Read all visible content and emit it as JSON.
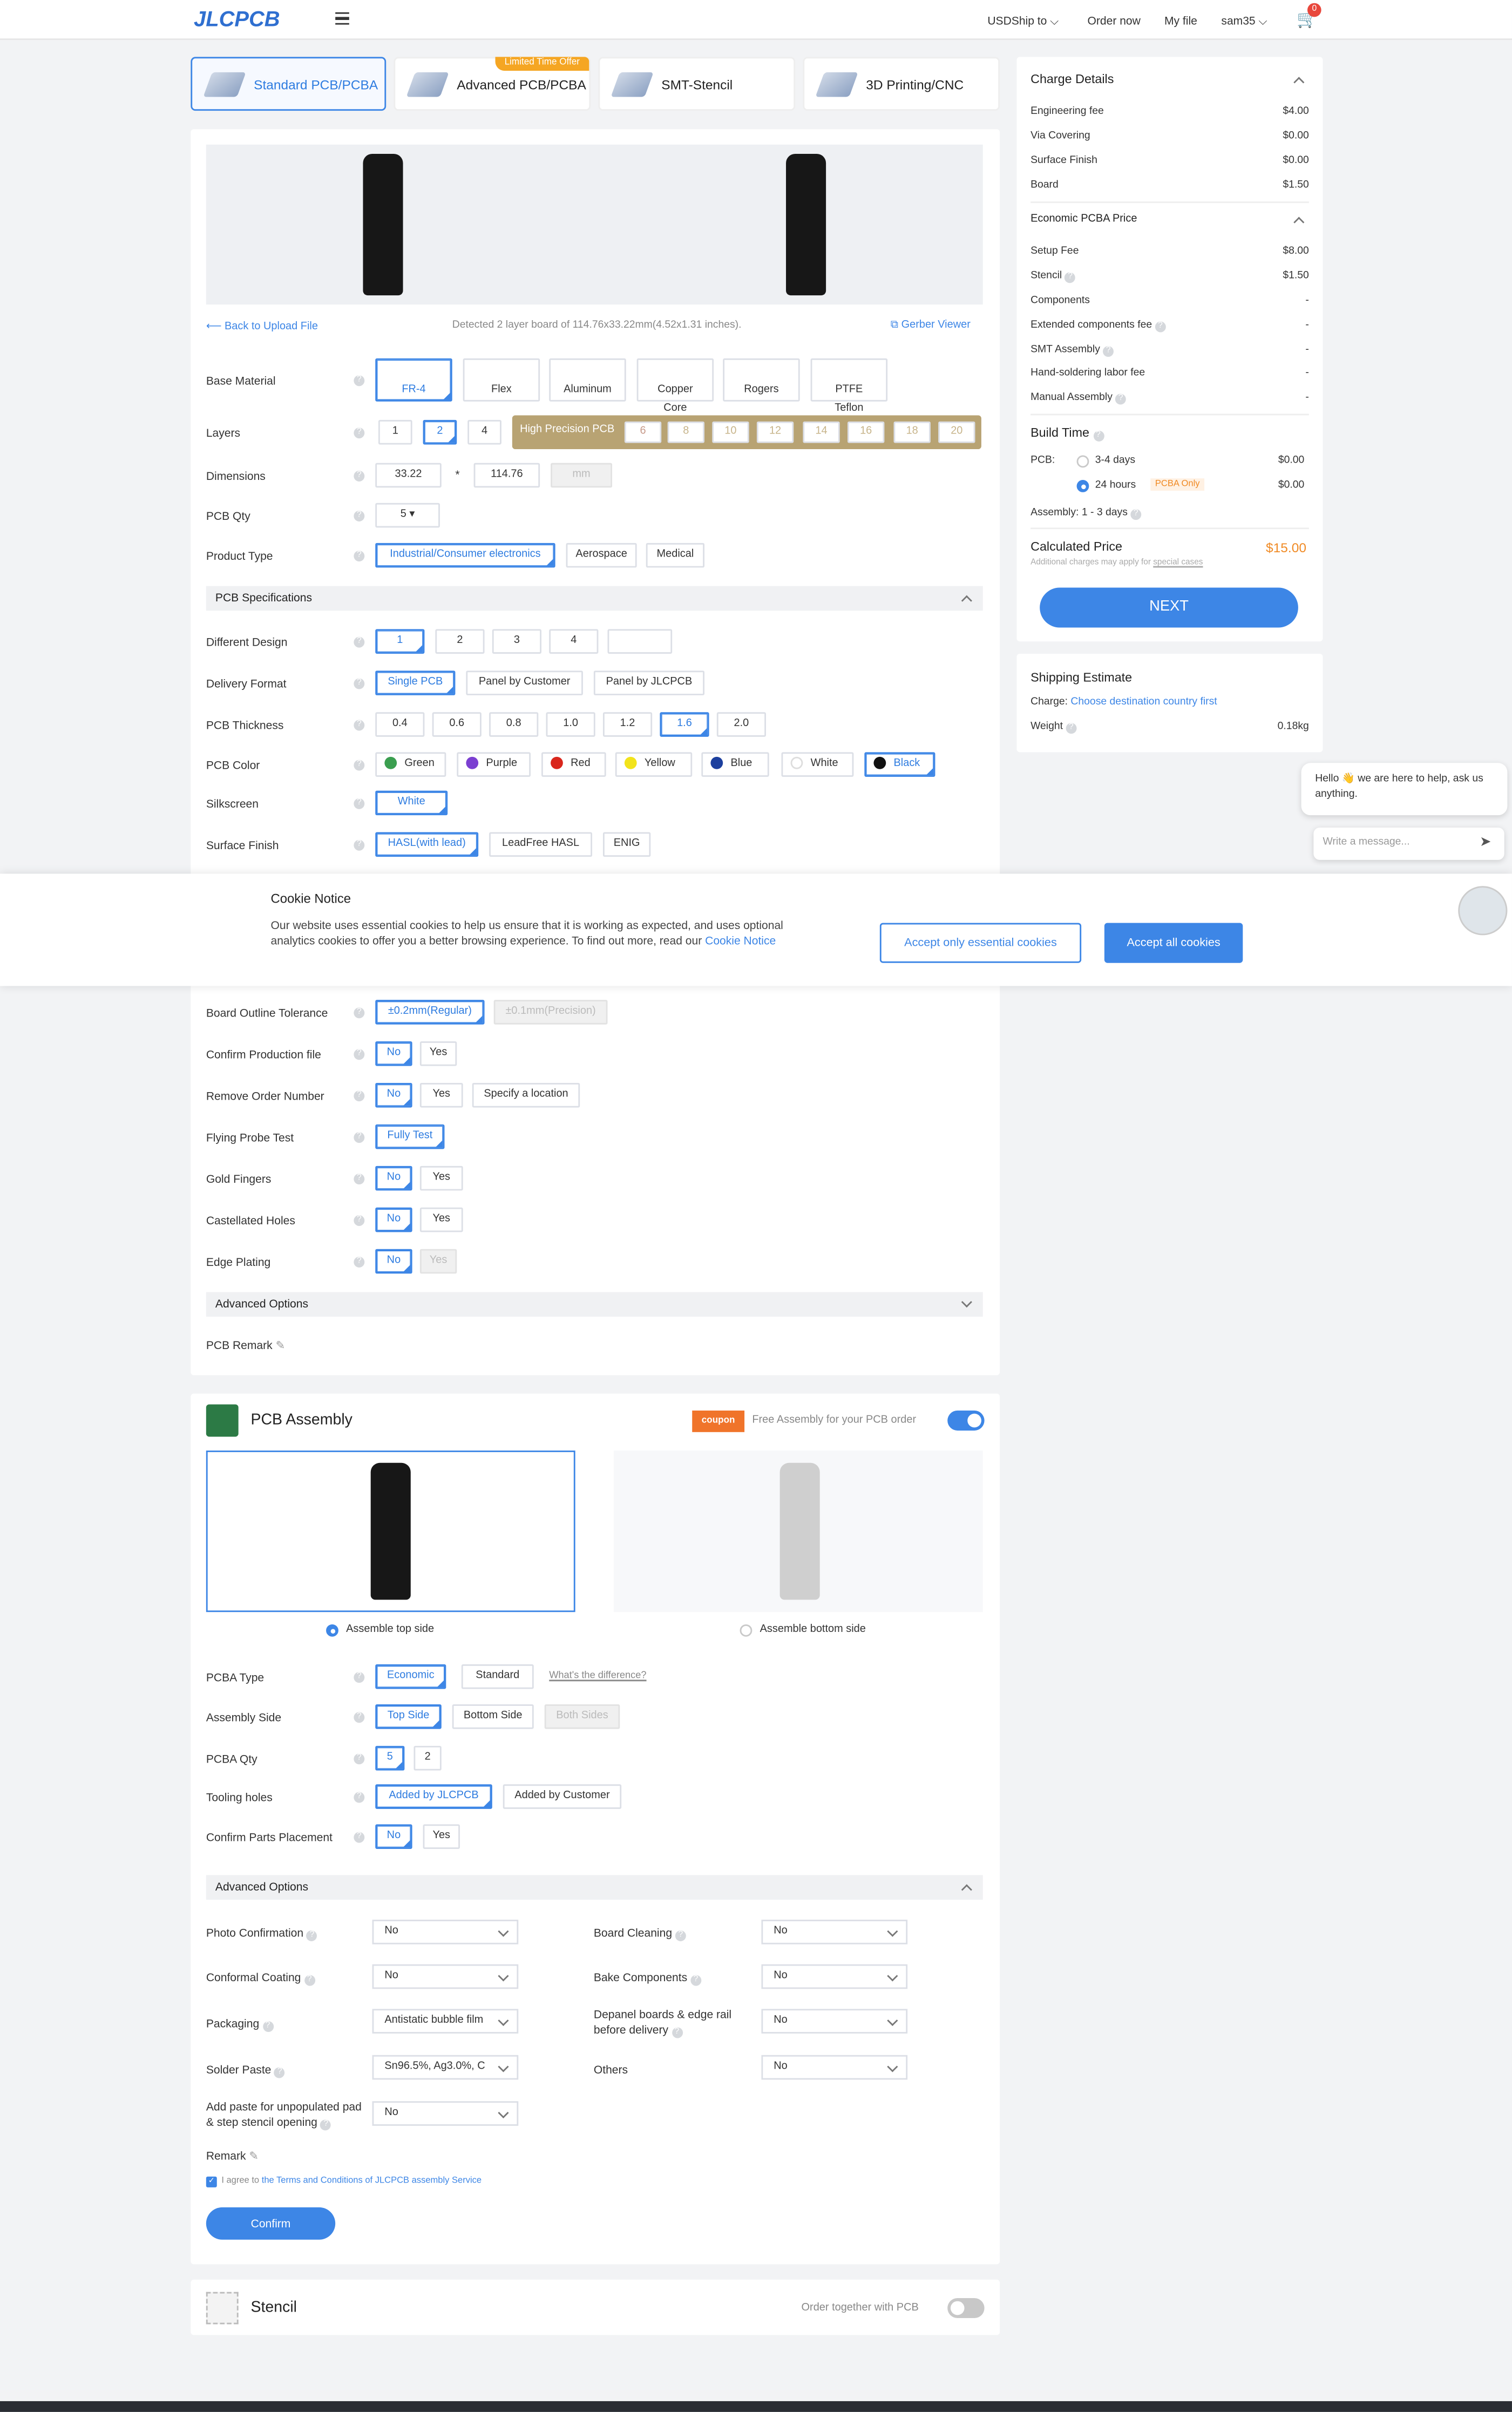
{
  "header": {
    "logo": "JLCPCB",
    "currency": "USD",
    "ship_to": "Ship to",
    "order_now": "Order now",
    "my_file": "My file",
    "user": "sam35",
    "cart_count": "0"
  },
  "tabs": [
    {
      "label": "Standard PCB/PCBA"
    },
    {
      "label": "Advanced PCB/PCBA",
      "badge": "Limited Time Offer"
    },
    {
      "label": "SMT-Stencil"
    },
    {
      "label": "3D Printing/CNC"
    }
  ],
  "upload": {
    "back": "Back to Upload File",
    "detected": "Detected 2 layer board of 114.76x33.22mm(4.52x1.31 inches).",
    "gerber_viewer": "Gerber Viewer"
  },
  "pcb": {
    "base_material": {
      "label": "Base Material",
      "options": [
        "FR-4",
        "Flex",
        "Aluminum",
        "Copper Core",
        "Rogers",
        "PTFE Teflon"
      ]
    },
    "layers": {
      "label": "Layers",
      "options": [
        "1",
        "2",
        "4"
      ],
      "hp_label": "High Precision PCB",
      "hp_options": [
        "6",
        "8",
        "10",
        "12",
        "14",
        "16",
        "18",
        "20"
      ]
    },
    "dimensions": {
      "label": "Dimensions",
      "width": "33.22",
      "sep": "*",
      "height": "114.76",
      "unit": "mm"
    },
    "qty": {
      "label": "PCB Qty",
      "value": "5"
    },
    "product_type": {
      "label": "Product Type",
      "options": [
        "Industrial/Consumer electronics",
        "Aerospace",
        "Medical"
      ]
    },
    "spec_title": "PCB Specifications",
    "different_design": {
      "label": "Different Design",
      "options": [
        "1",
        "2",
        "3",
        "4"
      ]
    },
    "delivery_format": {
      "label": "Delivery Format",
      "options": [
        "Single PCB",
        "Panel by Customer",
        "Panel by JLCPCB"
      ]
    },
    "thickness": {
      "label": "PCB Thickness",
      "options": [
        "0.4",
        "0.6",
        "0.8",
        "1.0",
        "1.2",
        "1.6",
        "2.0"
      ]
    },
    "color": {
      "label": "PCB Color",
      "options": [
        {
          "name": "Green",
          "color": "#3a9e4f"
        },
        {
          "name": "Purple",
          "color": "#7b3fd1"
        },
        {
          "name": "Red",
          "color": "#d9261c"
        },
        {
          "name": "Yellow",
          "color": "#f2e31b"
        },
        {
          "name": "Blue",
          "color": "#1c3f9e"
        },
        {
          "name": "White",
          "color": "#ffffff"
        },
        {
          "name": "Black",
          "color": "#111111"
        }
      ]
    },
    "silkscreen": {
      "label": "Silkscreen",
      "value": "White"
    },
    "surface_finish": {
      "label": "Surface Finish",
      "options": [
        "HASL(with lead)",
        "LeadFree HASL",
        "ENIG"
      ]
    },
    "outline_tolerance": {
      "label": "Board Outline Tolerance",
      "options": [
        "±0.2mm(Regular)",
        "±0.1mm(Precision)"
      ]
    },
    "confirm_file": {
      "label": "Confirm Production file",
      "options": [
        "No",
        "Yes"
      ]
    },
    "remove_order_number": {
      "label": "Remove Order Number",
      "options": [
        "No",
        "Yes",
        "Specify a location"
      ]
    },
    "flying_probe": {
      "label": "Flying Probe Test",
      "value": "Fully Test"
    },
    "gold_fingers": {
      "label": "Gold Fingers",
      "options": [
        "No",
        "Yes"
      ]
    },
    "castellated": {
      "label": "Castellated Holes",
      "options": [
        "No",
        "Yes"
      ]
    },
    "edge_plating": {
      "label": "Edge Plating",
      "options": [
        "No",
        "Yes"
      ]
    },
    "advanced_title": "Advanced Options",
    "remark": "PCB Remark"
  },
  "cookie": {
    "title": "Cookie Notice",
    "text": "Our website uses essential cookies to help us ensure that it is working as expected, and uses optional analytics cookies to offer you a better browsing experience. To find out more, read our",
    "link": "Cookie Notice",
    "essential": "Accept only essential cookies",
    "all": "Accept all cookies"
  },
  "assembly": {
    "title": "PCB Assembly",
    "coupon": "coupon",
    "promo": "Free Assembly for your PCB order",
    "top_side": "Assemble top side",
    "bottom_side": "Assemble bottom side",
    "pcba_type": {
      "label": "PCBA Type",
      "options": [
        "Economic",
        "Standard"
      ],
      "diff": "What's the difference?"
    },
    "assembly_side": {
      "label": "Assembly Side",
      "options": [
        "Top Side",
        "Bottom Side",
        "Both Sides"
      ]
    },
    "pcba_qty": {
      "label": "PCBA Qty",
      "options": [
        "5",
        "2"
      ]
    },
    "tooling": {
      "label": "Tooling holes",
      "options": [
        "Added by JLCPCB",
        "Added by Customer"
      ]
    },
    "confirm_parts": {
      "label": "Confirm Parts Placement",
      "options": [
        "No",
        "Yes"
      ]
    },
    "advanced_title": "Advanced Options",
    "adv": [
      {
        "label": "Photo Confirmation",
        "value": "No"
      },
      {
        "label": "Board Cleaning",
        "value": "No"
      },
      {
        "label": "Conformal Coating",
        "value": "No"
      },
      {
        "label": "Bake Components",
        "value": "No"
      },
      {
        "label": "Packaging",
        "value": "Antistatic bubble film"
      },
      {
        "label": "Depanel boards & edge rail before delivery",
        "value": "No"
      },
      {
        "label": "Solder Paste",
        "value": "Sn96.5%, Ag3.0%, C"
      },
      {
        "label": "Others",
        "value": "No"
      },
      {
        "label": "Add paste for unpopulated pad & step stencil opening",
        "value": "No"
      }
    ],
    "remark": "Remark",
    "agree": "I agree to",
    "terms": "the Terms and Conditions of JLCPCB assembly Service",
    "confirm": "Confirm"
  },
  "stencil": {
    "title": "Stencil",
    "order_together": "Order together with PCB"
  },
  "charges": {
    "title": "Charge Details",
    "rows": [
      {
        "k": "Engineering fee",
        "v": "$4.00"
      },
      {
        "k": "Via Covering",
        "v": "$0.00"
      },
      {
        "k": "Surface Finish",
        "v": "$0.00"
      },
      {
        "k": "Board",
        "v": "$1.50"
      }
    ],
    "pcba_title": "Economic PCBA Price",
    "pcba_rows": [
      {
        "k": "Setup Fee",
        "v": "$8.00"
      },
      {
        "k": "Stencil",
        "v": "$1.50"
      },
      {
        "k": "Components",
        "v": "-"
      },
      {
        "k": "Extended components fee",
        "v": "-"
      },
      {
        "k": "SMT Assembly",
        "v": "-"
      },
      {
        "k": "Hand-soldering labor fee",
        "v": "-"
      },
      {
        "k": "Manual Assembly",
        "v": "-"
      }
    ],
    "build_title": "Build Time",
    "pcb_label": "PCB:",
    "opt1": "3-4 days",
    "opt1_v": "$0.00",
    "opt2": "24 hours",
    "opt2_tag": "PCBA Only",
    "opt2_v": "$0.00",
    "assembly_label": "Assembly:",
    "assembly_days": "1 - 3 days",
    "calc_title": "Calculated Price",
    "calc_value": "$15.00",
    "calc_note": "Additional charges may apply for",
    "calc_note_link": "special cases",
    "next": "NEXT"
  },
  "shipping": {
    "title": "Shipping Estimate",
    "charge_label": "Charge:",
    "charge_link": "Choose destination country first",
    "weight_label": "Weight",
    "weight_value": "0.18kg"
  },
  "chat": {
    "greeting": "Hello 👋 we are here to help, ask us anything.",
    "placeholder": "Write a message..."
  }
}
